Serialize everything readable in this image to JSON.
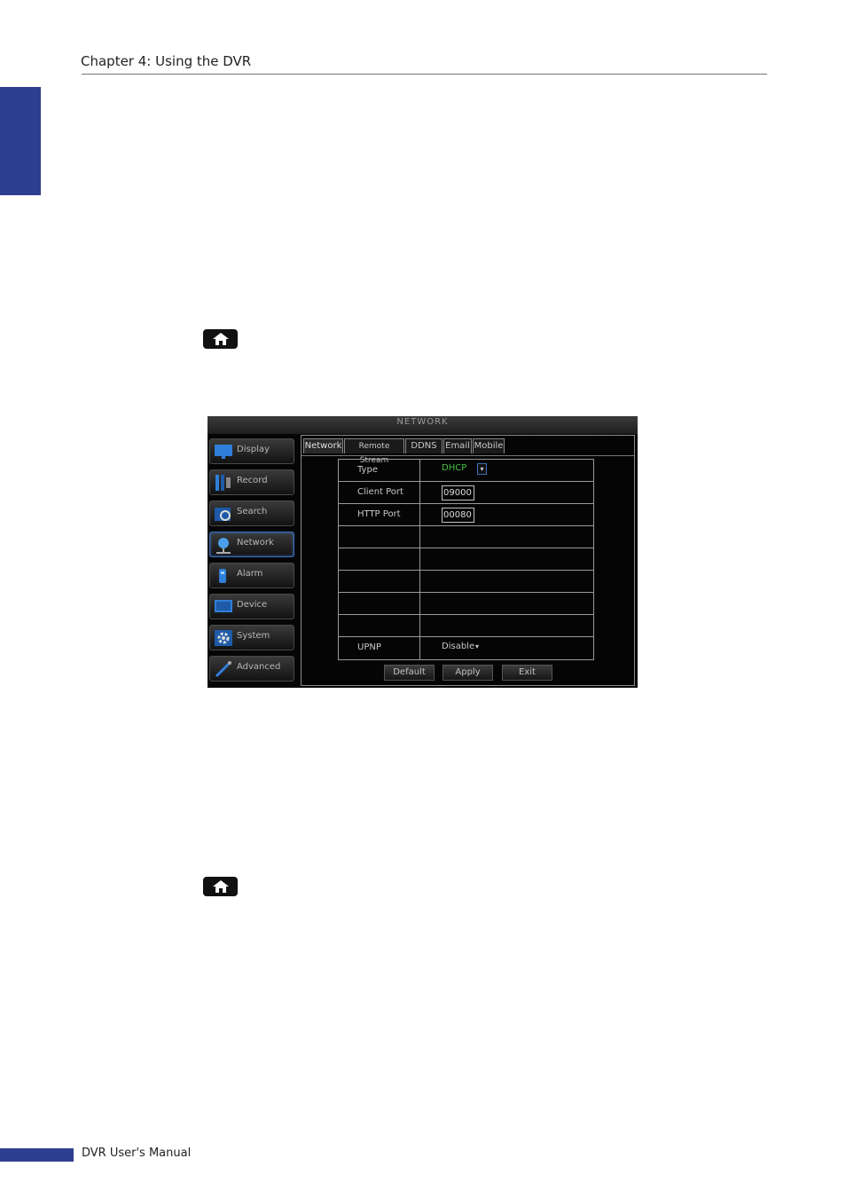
{
  "header": {
    "chapter": "Chapter 4: Using the DVR"
  },
  "home_buttons": [
    {
      "icon": "home-icon"
    },
    {
      "icon": "home-icon"
    }
  ],
  "dvr": {
    "title": "NETWORK",
    "menu": [
      {
        "label": "Display",
        "icon": "display-icon"
      },
      {
        "label": "Record",
        "icon": "record-icon"
      },
      {
        "label": "Search",
        "icon": "search-icon"
      },
      {
        "label": "Network",
        "icon": "network-icon"
      },
      {
        "label": "Alarm",
        "icon": "alarm-icon"
      },
      {
        "label": "Device",
        "icon": "device-icon"
      },
      {
        "label": "System",
        "icon": "gear-icon"
      },
      {
        "label": "Advanced",
        "icon": "advanced-icon"
      }
    ],
    "tabs": [
      "Network",
      "Remote Stream",
      "DDNS",
      "Email",
      "Mobile"
    ],
    "fields": {
      "type_label": "Type",
      "type_value": "DHCP",
      "client_port_label": "Client Port",
      "client_port_value": "09000",
      "http_port_label": "HTTP Port",
      "http_port_value": "00080",
      "upnp_label": "UPNP",
      "upnp_value": "Disable"
    },
    "buttons": {
      "default": "Default",
      "apply": "Apply",
      "exit": "Exit"
    },
    "colors": {
      "accent": "#3a70b8",
      "dhcp": "#44c044"
    }
  },
  "footer": {
    "manual": "DVR User's Manual"
  }
}
